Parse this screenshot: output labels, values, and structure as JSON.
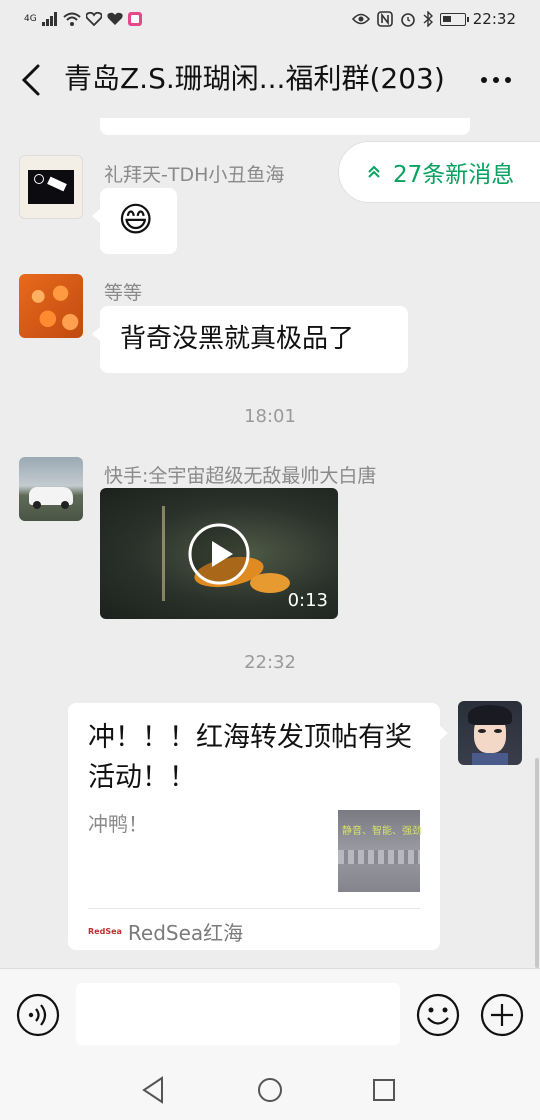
{
  "status_bar": {
    "network": "4G",
    "time": "22:32"
  },
  "header": {
    "title": "青岛Z.S.珊瑚闲...福利群(203)",
    "more_label": "···"
  },
  "new_messages": {
    "label": "27条新消息"
  },
  "messages": [
    {
      "sender": "礼拜天-TDH小丑鱼海",
      "text": "😄"
    },
    {
      "sender": "等等",
      "text": "背奇没黑就真极品了"
    },
    {
      "timestamp": "18:01"
    },
    {
      "sender": "快手:全宇宙超级无敌最帅大白唐",
      "video_duration": "0:13"
    },
    {
      "timestamp": "22:32"
    },
    {
      "card_title": "冲！！！红海转发顶帖有奖活动！！",
      "card_desc": "冲鸭！",
      "card_thumb_text": "静音、智能、强劲",
      "card_source_logo": "RedSea",
      "card_source": "RedSea红海"
    }
  ],
  "partial_top_bubble": "😄😄😄",
  "colors": {
    "accent_green": "#07a160",
    "background": "#ededed",
    "bubble": "#ffffff"
  },
  "icons": [
    "back-arrow-icon",
    "more-icon",
    "voice-icon",
    "emoji-icon",
    "plus-icon",
    "nav-back-icon",
    "nav-home-icon",
    "nav-recent-icon",
    "double-chevron-up-icon"
  ]
}
